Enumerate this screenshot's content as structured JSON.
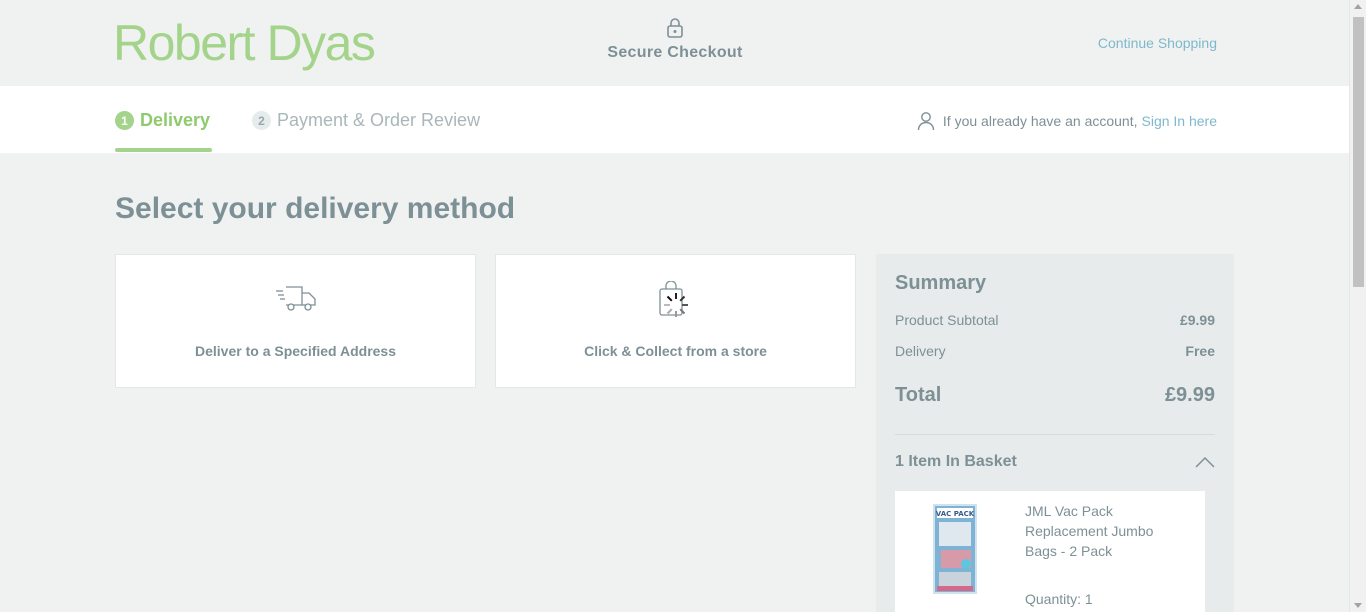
{
  "header": {
    "brand": "Robert Dyas",
    "secure_label": "Secure Checkout",
    "continue_label": "Continue Shopping"
  },
  "steps": [
    {
      "number": "1",
      "label": "Delivery",
      "active": true
    },
    {
      "number": "2",
      "label": "Payment & Order Review",
      "active": false
    }
  ],
  "account": {
    "prompt": "If you already have an account,",
    "link": "Sign In here"
  },
  "main": {
    "title": "Select your delivery method",
    "options": [
      {
        "label": "Deliver to a Specified Address",
        "icon": "delivery-truck-icon"
      },
      {
        "label": "Click & Collect from a store",
        "icon": "shopping-bag-icon"
      }
    ]
  },
  "summary": {
    "title": "Summary",
    "subtotal_label": "Product Subtotal",
    "subtotal_value": "£9.99",
    "delivery_label": "Delivery",
    "delivery_value": "Free",
    "total_label": "Total",
    "total_value": "£9.99",
    "basket_label": "1 Item In Basket",
    "item": {
      "name": "JML Vac Pack Replacement Jumbo Bags - 2 Pack",
      "quantity": "Quantity: 1",
      "image_text": "VAC PACK"
    }
  },
  "colors": {
    "brand_green": "#a4d38b",
    "link_blue": "#7fb8cc",
    "text": "#7d9096",
    "background": "#f0f2f1"
  }
}
